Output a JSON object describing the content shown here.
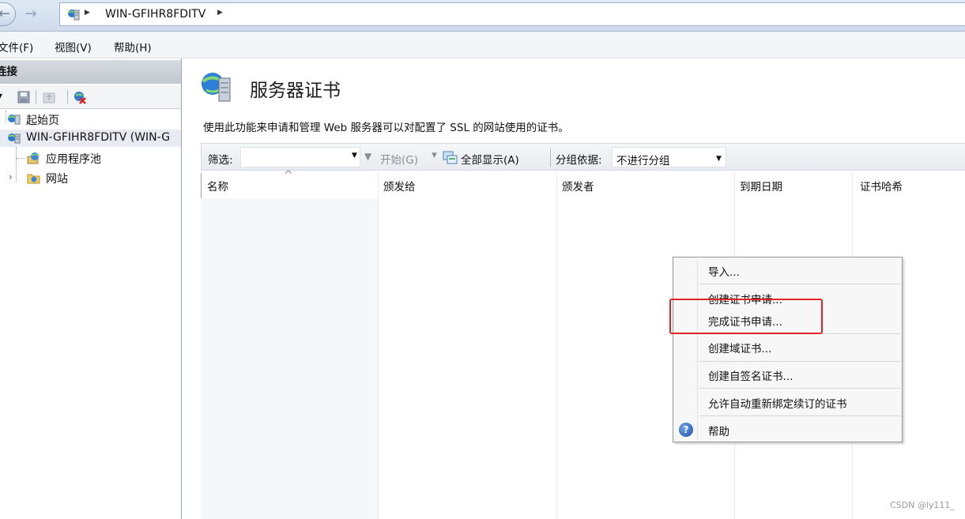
{
  "address": {
    "path": "WIN-GFIHR8FDITV"
  },
  "menubar": {
    "items": [
      "文件(F)",
      "视图(V)",
      "帮助(H)"
    ]
  },
  "connections": {
    "title": "连接",
    "tree": [
      {
        "label": "起始页",
        "icon": "start-page-icon"
      },
      {
        "label": "WIN-GFIHR8FDITV (WIN-G",
        "icon": "server-icon"
      },
      {
        "label": "应用程序池",
        "icon": "app-pool-icon"
      },
      {
        "label": "网站",
        "icon": "sites-folder-icon"
      }
    ]
  },
  "feature": {
    "title": "服务器证书",
    "description": "使用此功能来申请和管理 Web 服务器可以对配置了 SSL 的网站使用的证书。"
  },
  "filter": {
    "label": "筛选:",
    "go_label": "开始(G)",
    "show_all_label": "全部显示(A)",
    "group_by_label": "分组依据:",
    "group_by_value": "不进行分组"
  },
  "grid": {
    "columns": [
      "名称",
      "颁发给",
      "颁发者",
      "到期日期",
      "证书哈希"
    ]
  },
  "context_menu": {
    "items": [
      "导入...",
      "创建证书申请...",
      "完成证书申请...",
      "创建域证书...",
      "创建自签名证书...",
      "允许自动重新绑定续订的证书",
      "帮助"
    ]
  },
  "watermark": "CSDN @ly111_",
  "colors": {
    "highlight": "#e02424",
    "accent": "#1b4fa8"
  }
}
